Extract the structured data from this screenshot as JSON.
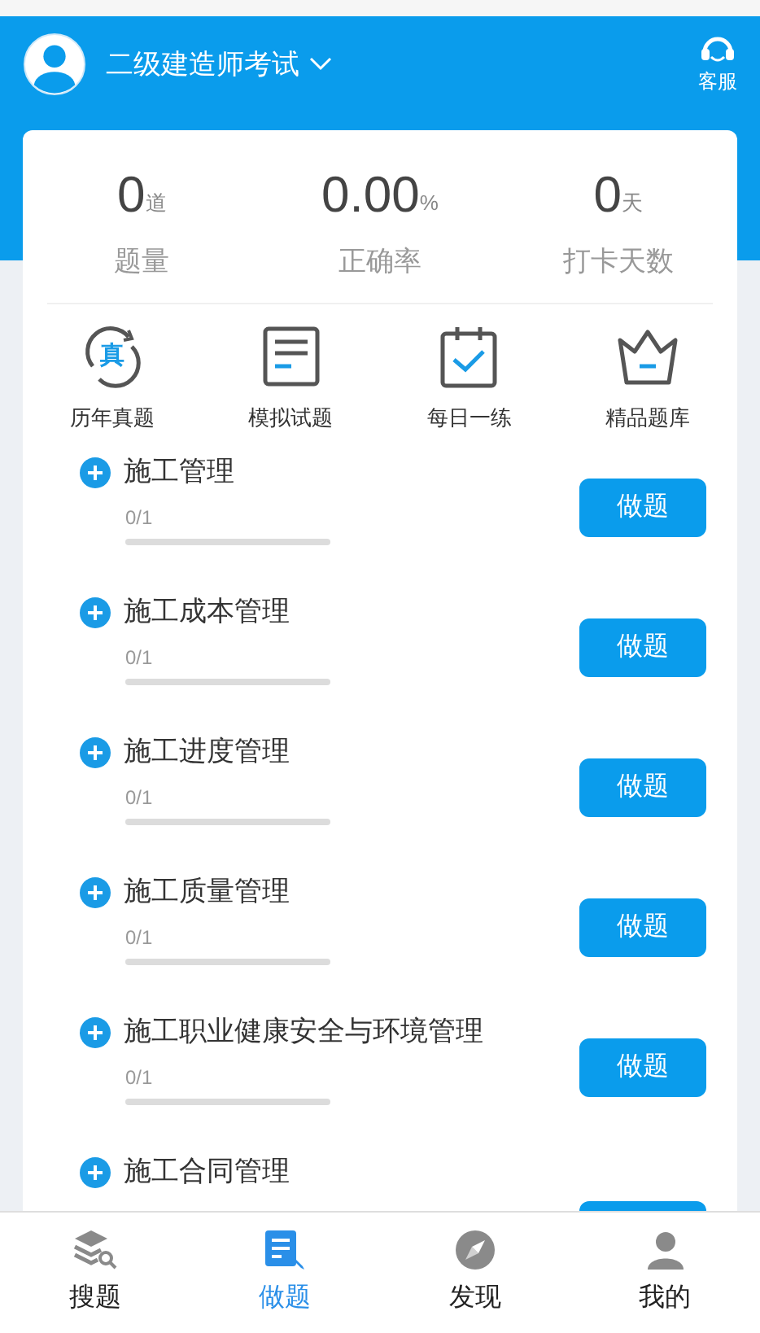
{
  "header": {
    "title": "二级建造师考试",
    "service_label": "客服"
  },
  "stats": [
    {
      "value": "0",
      "unit": "道",
      "label": "题量"
    },
    {
      "value": "0.00",
      "unit": "%",
      "label": "正确率"
    },
    {
      "value": "0",
      "unit": "天",
      "label": "打卡天数"
    }
  ],
  "shortcuts": [
    {
      "kind": "real",
      "label": "历年真题",
      "badge": "真"
    },
    {
      "kind": "paper",
      "label": "模拟试题"
    },
    {
      "kind": "calendar",
      "label": "每日一练"
    },
    {
      "kind": "crown",
      "label": "精品题库"
    }
  ],
  "chapters": [
    {
      "title": "施工管理",
      "progress": "0/1",
      "button": "做题"
    },
    {
      "title": "施工成本管理",
      "progress": "0/1",
      "button": "做题"
    },
    {
      "title": "施工进度管理",
      "progress": "0/1",
      "button": "做题"
    },
    {
      "title": "施工质量管理",
      "progress": "0/1",
      "button": "做题"
    },
    {
      "title": "施工职业健康安全与环境管理",
      "progress": "0/1",
      "button": "做题"
    },
    {
      "title": "施工合同管理"
    }
  ],
  "bottom_nav": [
    {
      "kind": "search",
      "label": "搜题",
      "selected": false
    },
    {
      "kind": "practice",
      "label": "做题",
      "selected": true
    },
    {
      "kind": "discover",
      "label": "发现",
      "selected": false
    },
    {
      "kind": "profile",
      "label": "我的",
      "selected": false
    }
  ]
}
